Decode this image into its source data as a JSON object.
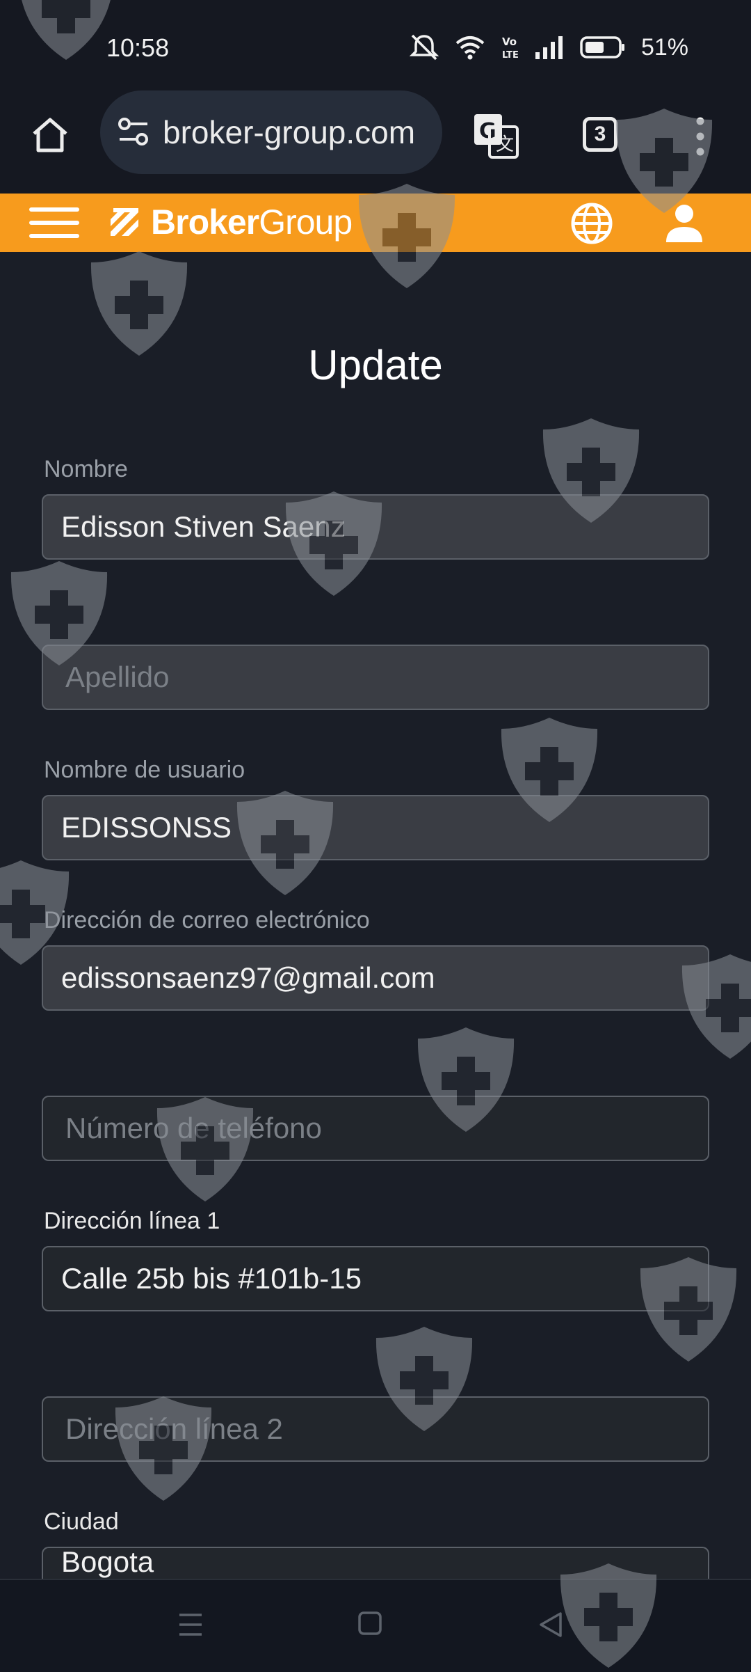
{
  "status_bar": {
    "time": "10:58",
    "battery": "51%",
    "icons": [
      "mute-icon",
      "wifi-icon",
      "volte-icon",
      "signal-icon",
      "battery-icon"
    ]
  },
  "browser": {
    "url": "broker-group.com",
    "tab_count": "3",
    "icons": [
      "home-icon",
      "site-settings-icon",
      "translate-icon",
      "tabs-icon",
      "more-icon"
    ]
  },
  "site": {
    "brand_bold": "Broker",
    "brand_light": "Group",
    "accent": "#f79b1d"
  },
  "form": {
    "title": "Update",
    "nombre_label": "Nombre",
    "nombre_value": "Edisson Stiven Saenz",
    "apellido_placeholder": "Apellido",
    "usuario_label": "Nombre de usuario",
    "usuario_value": "EDISSONSS",
    "correo_label": "Dirección de correo electrónico",
    "correo_value": "edissonsaenz97@gmail.com",
    "telefono_placeholder": "Número de teléfono",
    "direccion1_label": "Dirección línea 1",
    "direccion1_value": "Calle 25b bis #101b-15",
    "direccion2_placeholder": "Dirección línea 2",
    "ciudad_label": "Ciudad",
    "ciudad_value": "Bogota"
  },
  "nav": {
    "icons": [
      "recent-apps-icon",
      "home-square-icon",
      "back-icon"
    ]
  }
}
